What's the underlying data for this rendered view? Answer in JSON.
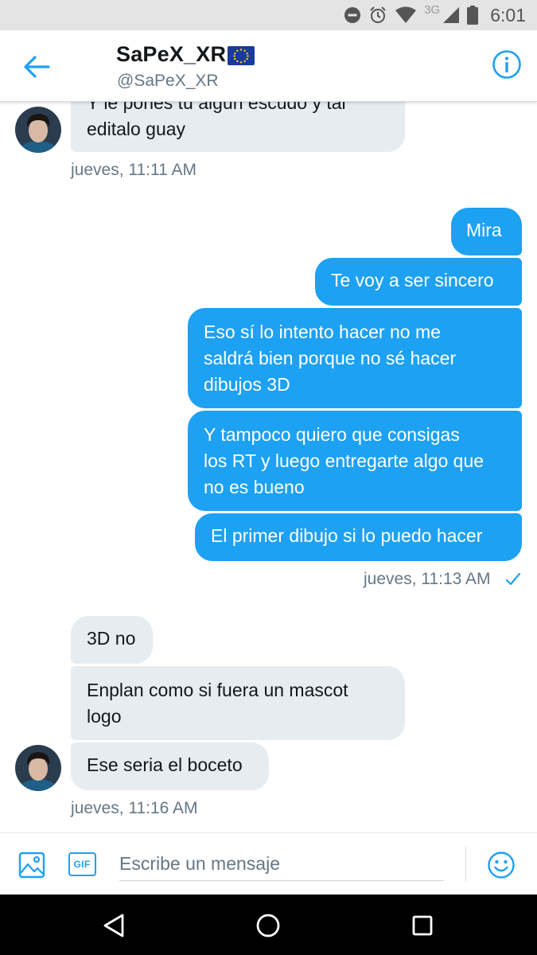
{
  "status_bar": {
    "network_type": "3G",
    "time": "6:01",
    "icons": [
      "do-not-disturb-icon",
      "alarm-icon",
      "wifi-icon",
      "signal-icon",
      "battery-icon"
    ]
  },
  "header": {
    "display_name": "SaPeX_XR",
    "handle": "@SaPeX_XR",
    "icons": [
      "back-arrow-icon",
      "eu-flag-icon",
      "info-icon"
    ]
  },
  "messages": {
    "m1": {
      "text_line_1": "Y le pones tu algún escudo y tal",
      "text_line_2": "editalo guay"
    },
    "ts1": "jueves, 11:11 AM",
    "m2": {
      "text": "Mira"
    },
    "m3": {
      "text": "Te voy a ser sincero"
    },
    "m4": {
      "text_line_1": "Eso sí lo intento hacer no me",
      "text_line_2": "saldrá bien porque no sé hacer",
      "text_line_3": "dibujos 3D"
    },
    "m5": {
      "text_line_1": "Y tampoco quiero que consigas",
      "text_line_2": "los RT y luego entregarte algo que",
      "text_line_3": "no es bueno"
    },
    "m6": {
      "text": "El primer dibujo si lo puedo hacer"
    },
    "ts2": "jueves, 11:13 AM",
    "m7": {
      "text": "3D no"
    },
    "m8": {
      "text_line_1": "Enplan como si fuera un mascot",
      "text_line_2": "logo"
    },
    "m9": {
      "text": "Ese seria el boceto"
    },
    "ts3": "jueves, 11:16 AM"
  },
  "composer": {
    "placeholder": "Escribe un mensaje",
    "gif_label": "GIF"
  },
  "colors": {
    "accent": "#1da1f2",
    "incoming_bubble": "#e6ecf0",
    "secondary_text": "#657786"
  }
}
